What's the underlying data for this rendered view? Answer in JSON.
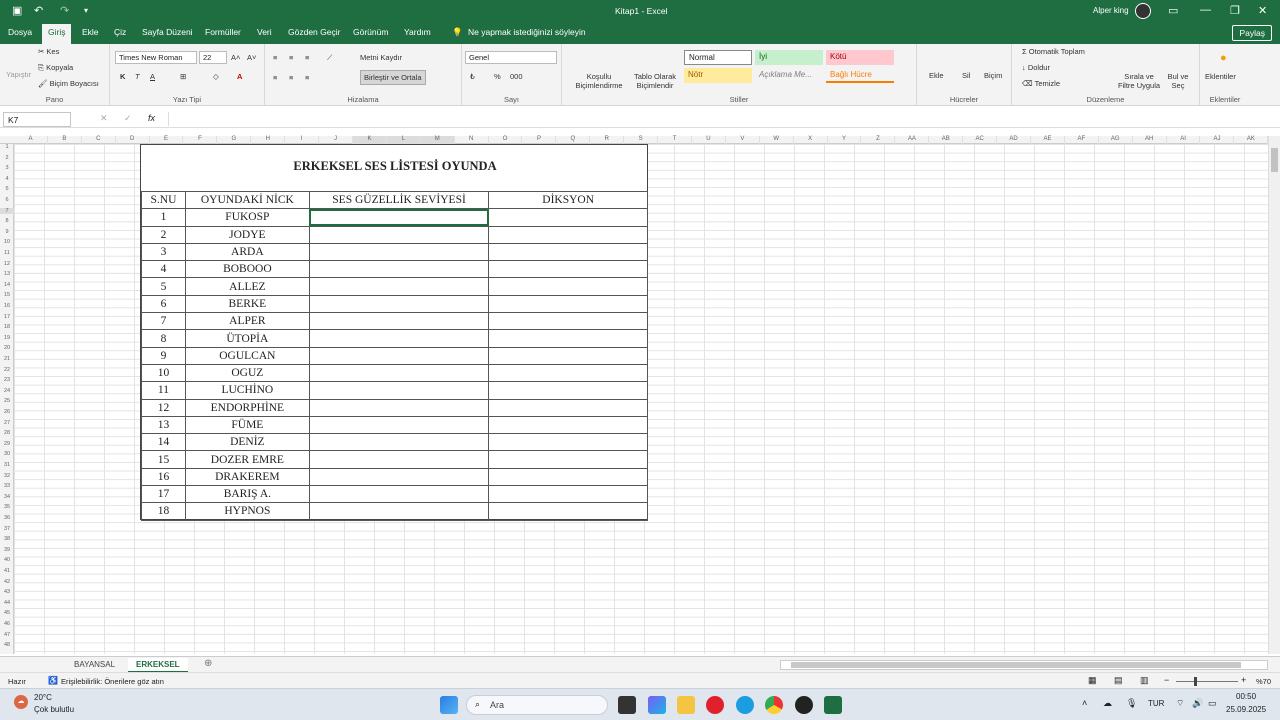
{
  "window": {
    "title": "Kitap1 - Excel",
    "user": "Alper king"
  },
  "menu_tabs": [
    "Dosya",
    "Giriş",
    "Ekle",
    "Çiz",
    "Sayfa Düzeni",
    "Formüller",
    "Veri",
    "Gözden Geçir",
    "Görünüm",
    "Yardım"
  ],
  "tell_me": "Ne yapmak istediğinizi söyleyin",
  "share": "Paylaş",
  "ribbon": {
    "paste": "Yapıştır",
    "cut": "Kes",
    "copy": "Kopyala",
    "format_painter": "Biçim Boyacısı",
    "clipboard": "Pano",
    "font_name": "Times New Roman",
    "font_size": "22",
    "font_group": "Yazı Tipi",
    "wrap_text": "Metni Kaydır",
    "merge_center": "Birleştir ve Ortala",
    "alignment": "Hizalama",
    "number_format": "Genel",
    "number_group": "Sayı",
    "cond_format": "Koşullu Biçimlendirme",
    "format_table": "Tablo Olarak Biçimlendir",
    "style_normal": "Normal",
    "style_good": "İyi",
    "style_bad": "Kötü",
    "style_neutral": "Nötr",
    "style_explanatory": "Açıklama Me...",
    "style_linked": "Bağlı Hücre",
    "styles": "Stiller",
    "insert": "Ekle",
    "delete": "Sil",
    "format": "Biçim",
    "cells": "Hücreler",
    "autosum": "Otomatik Toplam",
    "fill": "Doldur",
    "clear": "Temizle",
    "sort_filter": "Sırala ve Filtre Uygula",
    "find_select": "Bul ve Seç",
    "editing": "Düzenleme",
    "addins": "Eklentiler",
    "addins_group": "Eklentiler"
  },
  "name_box": "K7",
  "columns": [
    "A",
    "B",
    "C",
    "D",
    "E",
    "F",
    "G",
    "H",
    "I",
    "J",
    "K",
    "L",
    "M",
    "N",
    "O",
    "P",
    "Q",
    "R",
    "S",
    "T",
    "U",
    "V",
    "W",
    "X",
    "Y",
    "Z",
    "AA",
    "AB",
    "AC",
    "AD",
    "AE",
    "AF",
    "AG",
    "AH",
    "AI",
    "AJ",
    "AK"
  ],
  "rows": [
    "1",
    "2",
    "3",
    "4",
    "5",
    "6",
    "7",
    "8",
    "9",
    "10",
    "11",
    "12",
    "13",
    "14",
    "15",
    "16",
    "17",
    "18",
    "19",
    "20",
    "21",
    "22",
    "23",
    "24",
    "25",
    "26",
    "27",
    "28",
    "29",
    "30",
    "31",
    "32",
    "33",
    "34",
    "35",
    "36",
    "37",
    "38",
    "39",
    "40",
    "41",
    "42",
    "43",
    "44",
    "45",
    "46",
    "47",
    "48"
  ],
  "sheet": {
    "title": "ERKEKSEL SES LİSTESİ OYUNDA",
    "headers": [
      "S.NU",
      "OYUNDAKİ NİCK",
      "SES GÜZELLİK SEVİYESİ",
      "DİKSYON"
    ],
    "rows": [
      [
        "1",
        "FUKOSP"
      ],
      [
        "2",
        "JODYE"
      ],
      [
        "3",
        "ARDA"
      ],
      [
        "4",
        "BOBOOO"
      ],
      [
        "5",
        "ALLEZ"
      ],
      [
        "6",
        "BERKE"
      ],
      [
        "7",
        "ALPER"
      ],
      [
        "8",
        "ÜTOPİA"
      ],
      [
        "9",
        "OGULCAN"
      ],
      [
        "10",
        "OGUZ"
      ],
      [
        "11",
        "LUCHİNO"
      ],
      [
        "12",
        "ENDORPHİNE"
      ],
      [
        "13",
        "FÜME"
      ],
      [
        "14",
        "DENİZ"
      ],
      [
        "15",
        "DOZER EMRE"
      ],
      [
        "16",
        "DRAKEREM"
      ],
      [
        "17",
        "BARIŞ A."
      ],
      [
        "18",
        "HYPNOS"
      ]
    ]
  },
  "sheet_tabs": [
    "BAYANSAL",
    "ERKEKSEL"
  ],
  "status": {
    "ready": "Hazır",
    "accessibility": "Erişilebilirlik: Önerilere göz atın",
    "zoom": "%70"
  },
  "taskbar": {
    "weather_temp": "20°C",
    "weather_desc": "Çok bulutlu",
    "search": "Ara",
    "lang": "TUR",
    "time": "00:50",
    "date": "25.09.2025"
  },
  "colors": {
    "excel_green": "#1e6e42"
  }
}
